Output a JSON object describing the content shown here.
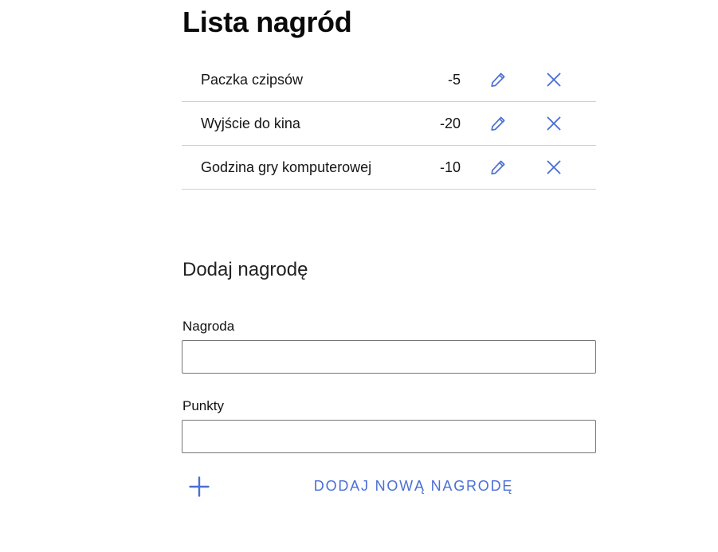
{
  "page": {
    "title": "Lista nagród"
  },
  "rewards": [
    {
      "name": "Paczka czipsów",
      "points": "-5"
    },
    {
      "name": "Wyjście do kina",
      "points": "-20"
    },
    {
      "name": "Godzina gry komputerowej",
      "points": "-10"
    }
  ],
  "icons": {
    "edit": "pencil-icon",
    "delete": "close-icon",
    "add": "plus-icon"
  },
  "form": {
    "section_title": "Dodaj nagrodę",
    "reward_label": "Nagroda",
    "reward_value": "",
    "points_label": "Punkty",
    "points_value": "",
    "add_button_label": "DODAJ NOWĄ NAGRODĘ"
  },
  "colors": {
    "accent": "#4a6fd6",
    "divider": "#cfcfcf",
    "input_border": "#767676"
  }
}
